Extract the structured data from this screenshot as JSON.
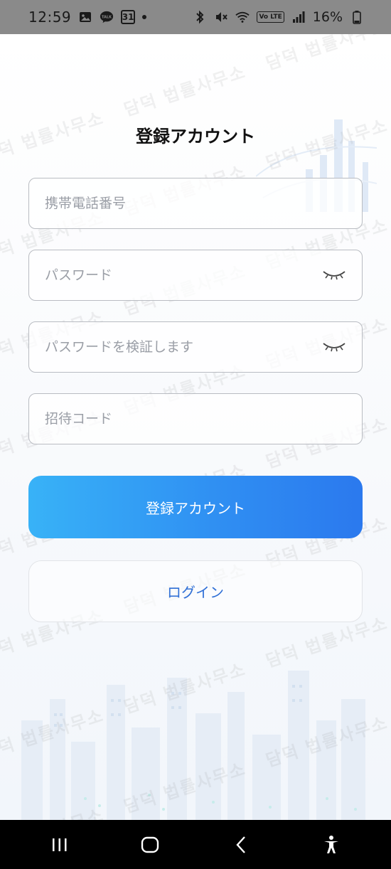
{
  "status_bar": {
    "time": "12:59",
    "notification_icons": [
      "image-icon",
      "kakaotalk-icon",
      "calendar-icon",
      "dot-icon"
    ],
    "talk_badge": "TALK",
    "calendar_day": "31",
    "right_icons": [
      "bluetooth-icon",
      "mute-icon",
      "wifi-icon",
      "volte-icon",
      "signal-icon",
      "battery-icon"
    ],
    "volte_label": "Vo LTE",
    "battery": "16%"
  },
  "page": {
    "title": "登録アカウント"
  },
  "form": {
    "phone": {
      "value": "",
      "placeholder": "携帯電話番号"
    },
    "password": {
      "value": "",
      "placeholder": "パスワード",
      "toggle_icon": "eye-closed-icon"
    },
    "confirm_password": {
      "value": "",
      "placeholder": "パスワードを検証します",
      "toggle_icon": "eye-closed-icon"
    },
    "invite_code": {
      "value": "",
      "placeholder": "招待コード"
    }
  },
  "actions": {
    "register_label": "登録アカウント",
    "login_label": "ログイン"
  },
  "watermark": {
    "text": "담덕 법률사무소"
  },
  "nav_bar": {
    "buttons": [
      "recents-icon",
      "home-icon",
      "back-icon",
      "accessibility-icon"
    ]
  },
  "colors": {
    "primary_gradient_start": "#38b2f7",
    "primary_gradient_end": "#2b79ee",
    "link_blue": "#2f6fd6",
    "status_bar_bg": "#8a8a8a",
    "nav_bar_bg": "#000000"
  }
}
